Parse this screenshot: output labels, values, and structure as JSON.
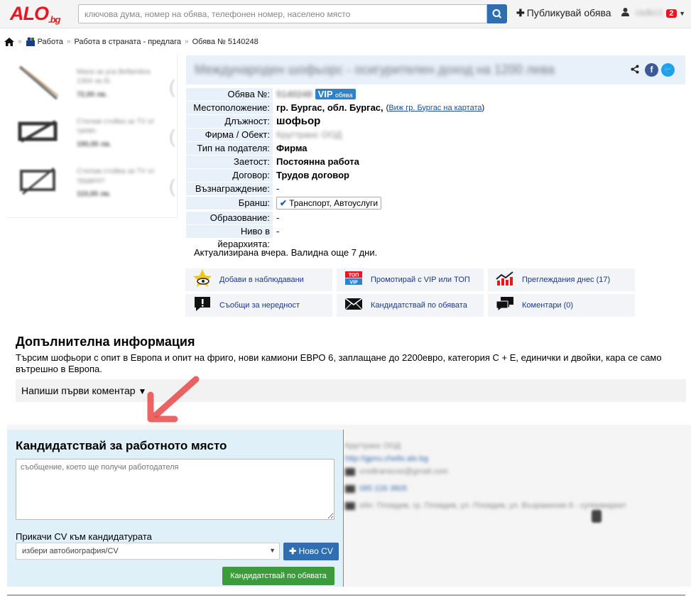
{
  "header": {
    "logo": "ALO",
    "logo_suffix": ".bg",
    "search_placeholder": "ключова дума, номер на обява, телефонен номер, населено място",
    "publish_label": "Публикувай обява",
    "username": "radko1",
    "notifications": "2"
  },
  "breadcrumb": [
    "Работа",
    "Работа в страната - предлага",
    "Обява № 5140248"
  ],
  "related": [
    {
      "title": "Маса за уса Bellambra 1304 за бг.",
      "price": "72,00 лв."
    },
    {
      "title": "Стелаж стойка за ТV от трево.",
      "price": "190,00 лв."
    },
    {
      "title": "Стелаж стойка за ТV от трудкост",
      "price": "110,00 лв."
    }
  ],
  "listing": {
    "title": "Международен шофьорс - осигурителен доход на 1200 лева",
    "rows": [
      {
        "label": "Обява №:",
        "value": "5140248"
      },
      {
        "label": "Местоположение:",
        "value": "гр. Бургас, обл. Бургас,",
        "link": "Виж гр. Бургас на картата"
      },
      {
        "label": "Длъжност:",
        "value": "шофьор"
      },
      {
        "label": "Фирма / Обект:",
        "value": "Кругтранс ООД"
      },
      {
        "label": "Тип на подателя:",
        "value": "Фирма"
      },
      {
        "label": "Заетост:",
        "value": "Постоянна работа"
      },
      {
        "label": "Договор:",
        "value": "Трудов договор"
      },
      {
        "label": "Възнаграждение:",
        "value": "-"
      },
      {
        "label": "Бранш:",
        "value": "Транспорт, Автоуслуги"
      },
      {
        "label": "Образование:",
        "value": "-"
      },
      {
        "label": "Ниво в йерархията:",
        "value": "-"
      }
    ],
    "vip_label": "VIP",
    "vip_small": "обява",
    "updated": "Актуализирана вчера. Валидна още 7 дни."
  },
  "actions": [
    {
      "label": "Добави в наблюдавани",
      "icon": "star-eye-icon"
    },
    {
      "label": "Промотирай с VIP или ТОП",
      "icon": "top-vip-icon"
    },
    {
      "label": "Преглеждания днес (17)",
      "icon": "chart-icon"
    },
    {
      "label": "Съобщи за нередност",
      "icon": "alert-icon"
    },
    {
      "label": "Кандидатствай по обявата",
      "icon": "envelope-icon"
    },
    {
      "label": "Коментари (0)",
      "icon": "comments-icon"
    }
  ],
  "additional": {
    "title": "Допълнителна информация",
    "text": "Търсим шофьори с опит в Европа и опит на фриго, нови камиони ЕВРО 6, заплащане до 2200евро, категория С + Е, единички и двойки, кара се само вътрешно в Европа.",
    "comment_label": "Напиши първи коментар"
  },
  "apply": {
    "title": "Кандидатствай за работното място",
    "message_placeholder": "съобщение, което ще получи работодателя",
    "cv_label": "Прикачи CV към кандидатурата",
    "cv_select": "избери автобиография/CV",
    "new_cv": "Ново CV",
    "submit": "Кандидатствай по обявата"
  },
  "company": {
    "name": "Кругтранс ООД",
    "site": "http://gpnu.chello.alo.bg",
    "email": "crodtranscoo@gmail.com",
    "phone": "085 226 3805",
    "address": "обл. Пловдив, гр. Пловдив, ул. Пловдив, ул. Възражение 8 - супермаркет"
  },
  "colors": {
    "brand": "#e8171f",
    "accent": "#2f6fb0",
    "label_bg": "#e8f0f9",
    "apply_bg": "#dff0f9",
    "green": "#3c9c3c"
  }
}
